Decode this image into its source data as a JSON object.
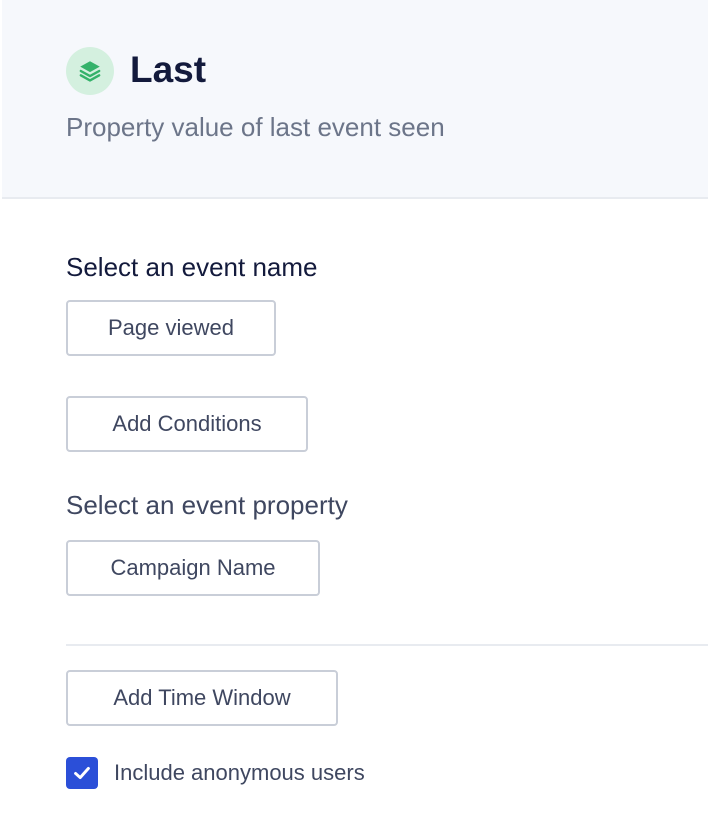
{
  "header": {
    "title": "Last",
    "subtitle": "Property value of last event seen",
    "icon": "stacked-layers-icon",
    "icon_color": "#34b26a",
    "icon_bg": "#d4f0df"
  },
  "event_section": {
    "label": "Select an event name",
    "event_button_label": "Page viewed",
    "conditions_button_label": "Add Conditions"
  },
  "property_section": {
    "label": "Select an event property",
    "property_button_label": "Campaign Name"
  },
  "time_window": {
    "button_label": "Add Time Window"
  },
  "anonymous": {
    "label": "Include anonymous users",
    "checked": true,
    "checkbox_color": "#2b4fd8"
  }
}
